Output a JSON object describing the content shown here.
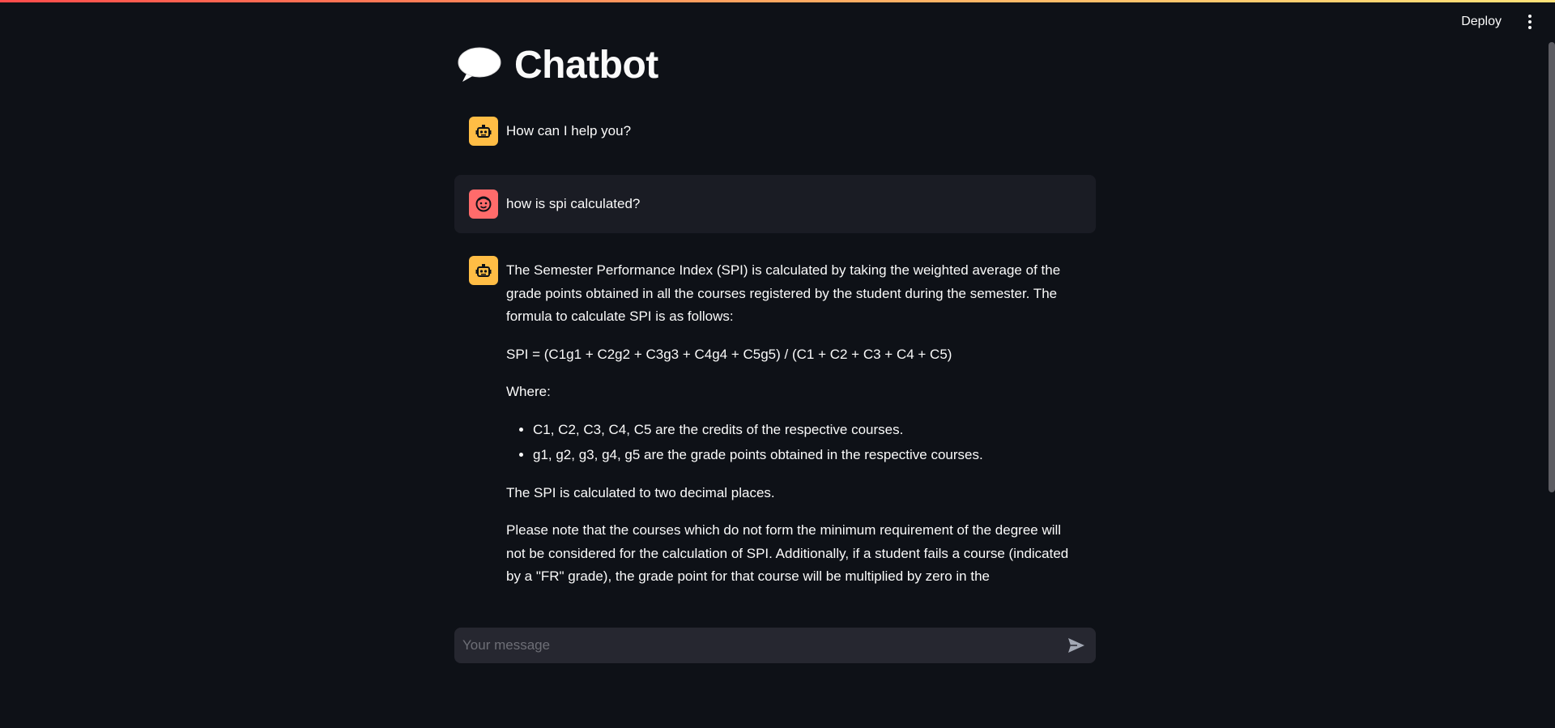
{
  "header": {
    "deploy_label": "Deploy",
    "menu_icon": "kebab-menu-icon"
  },
  "page": {
    "title": "Chatbot",
    "title_icon": "speech-balloon-icon"
  },
  "messages": [
    {
      "role": "assistant",
      "avatar_icon": "robot-icon",
      "paragraphs": [
        "How can I help you?"
      ]
    },
    {
      "role": "user",
      "avatar_icon": "smiley-face-icon",
      "paragraphs": [
        "how is spi calculated?"
      ]
    },
    {
      "role": "assistant",
      "avatar_icon": "robot-icon",
      "paragraphs": [
        "The Semester Performance Index (SPI) is calculated by taking the weighted average of the grade points obtained in all the courses registered by the student during the semester. The formula to calculate SPI is as follows:",
        "SPI = (C1g1 + C2g2 + C3g3 + C4g4 + C5g5) / (C1 + C2 + C3 + C4 + C5)",
        "Where:"
      ],
      "bullets": [
        "C1, C2, C3, C4, C5 are the credits of the respective courses.",
        "g1, g2, g3, g4, g5 are the grade points obtained in the respective courses."
      ],
      "after_paragraphs": [
        "The SPI is calculated to two decimal places.",
        "Please note that the courses which do not form the minimum requirement of the degree will not be considered for the calculation of SPI. Additionally, if a student fails a course (indicated by a \"FR\" grade), the grade point for that course will be multiplied by zero in the"
      ]
    }
  ],
  "chat_input": {
    "placeholder": "Your message",
    "value": "",
    "send_icon": "send-arrow-icon"
  },
  "colors": {
    "background": "#0e1117",
    "assistant_avatar": "#ffbd45",
    "user_avatar": "#ff6b6b",
    "user_bubble": "#1a1c24",
    "input_bg": "#262730"
  }
}
